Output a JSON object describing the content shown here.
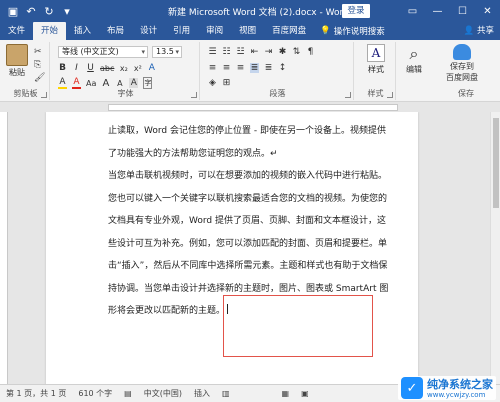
{
  "titlebar": {
    "title": "新建 Microsoft Word 文档 (2).docx  -  Word",
    "login": "登录",
    "quick_access": [
      "save-icon",
      "undo-icon",
      "redo-icon",
      "customize-icon"
    ]
  },
  "tabs": [
    "文件",
    "开始",
    "插入",
    "布局",
    "设计",
    "引用",
    "审阅",
    "视图",
    "百度网盘"
  ],
  "active_tab": "开始",
  "tellme": "操作说明搜索",
  "share": "共享",
  "ribbon": {
    "clipboard": {
      "paste": "粘贴",
      "label": "剪贴板"
    },
    "font": {
      "name": "等线 (中文正文)",
      "size": "13.5",
      "label": "字体",
      "row2": [
        "B",
        "I",
        "U",
        "abc",
        "x₂",
        "x²",
        "A"
      ],
      "row3": [
        "A",
        "A",
        "Aa",
        "A",
        "A",
        "A",
        "字"
      ]
    },
    "paragraph": {
      "label": "段落"
    },
    "styles": {
      "button": "样式",
      "label": "样式"
    },
    "editing": {
      "button": "编辑"
    },
    "save": {
      "line1": "保存到",
      "line2": "百度网盘",
      "label": "保存"
    }
  },
  "document": {
    "lines": [
      "止读取，Word 会记住您的停止位置 - 即使在另一个设备上。视频提供",
      "了功能强大的方法帮助您证明您的观点。↵",
      "当您单击联机视频时，可以在想要添加的视频的嵌入代码中进行粘贴。",
      "您也可以键入一个关键字以联机搜索最适合您的文档的视频。为使您的",
      "文档具有专业外观，Word 提供了页眉、页脚、封面和文本框设计，这",
      "些设计可互为补充。例如，您可以添加匹配的封面、页眉和提要栏。单",
      "击“插入”，然后从不同库中选择所需元素。主题和样式也有助于文档保",
      "持协调。当您单击设计并选择新的主题时，图片、图表或 SmartArt 图",
      "形将会更改以匹配新的主题。"
    ]
  },
  "status": {
    "page": "第 1 页，共 1 页",
    "words": "610 个字",
    "lang": "中文(中国)",
    "mode": "插入"
  },
  "watermark": {
    "name": "纯净系统之家",
    "url": "www.ycwjzy.com"
  },
  "colors": {
    "accent": "#2b579a",
    "highlight_box": "#e2534a"
  }
}
